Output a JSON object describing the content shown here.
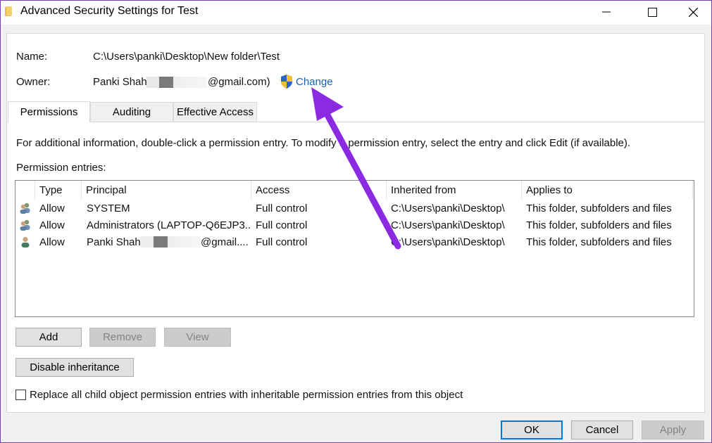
{
  "window": {
    "title": "Advanced Security Settings for Test",
    "controls": [
      "minimize",
      "maximize",
      "close"
    ]
  },
  "name_field": {
    "label": "Name:",
    "value": "C:\\Users\\panki\\Desktop\\New folder\\Test"
  },
  "owner_field": {
    "label": "Owner:",
    "value_prefix": "Panki Shah (",
    "value_suffix": "@gmail.com)",
    "change_link": "Change"
  },
  "tabs": [
    {
      "label": "Permissions",
      "active": true
    },
    {
      "label": "Auditing",
      "active": false
    },
    {
      "label": "Effective Access",
      "active": false
    }
  ],
  "info_text": "For additional information, double-click a permission entry. To modify a permission entry, select the entry and click Edit (if available).",
  "entries_label": "Permission entries:",
  "columns": [
    "Type",
    "Principal",
    "Access",
    "Inherited from",
    "Applies to"
  ],
  "rows": [
    {
      "icon": "group-users-icon",
      "type": "Allow",
      "principal": "SYSTEM",
      "access": "Full control",
      "inherited": "C:\\Users\\panki\\Desktop\\",
      "applies": "This folder, subfolders and files"
    },
    {
      "icon": "group-users-icon",
      "type": "Allow",
      "principal": "Administrators (LAPTOP-Q6EJP3...",
      "access": "Full control",
      "inherited": "C:\\Users\\panki\\Desktop\\",
      "applies": "This folder, subfolders and files"
    },
    {
      "icon": "single-user-icon",
      "type": "Allow",
      "principal_prefix": "Panki Shah (",
      "principal_suffix": "@gmail....",
      "access": "Full control",
      "inherited": "C:\\Users\\panki\\Desktop\\",
      "applies": "This folder, subfolders and files"
    }
  ],
  "buttons": {
    "add": "Add",
    "remove": "Remove",
    "view": "View",
    "disable_inheritance": "Disable inheritance",
    "ok": "OK",
    "cancel": "Cancel",
    "apply": "Apply"
  },
  "replace_checkbox": {
    "label": "Replace all child object permission entries with inheritable permission entries from this object",
    "checked": false
  },
  "colors": {
    "link": "#1a5fb4",
    "arrow": "#8a2be2",
    "default_button_border": "#0078d7"
  }
}
